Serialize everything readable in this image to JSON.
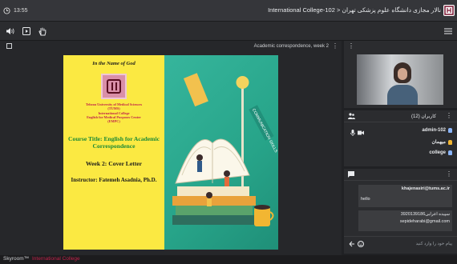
{
  "topbar": {
    "time": "13:55",
    "title": "International College-102 > نالار مجازی دانشگاه علوم پزشکی تهران"
  },
  "main": {
    "title": "Academic correspondence, week 2",
    "slide": {
      "heading": "In the Name of God",
      "institution": [
        "Tehran University of Medical Sciences",
        "(TUMS)",
        "International College",
        "English for Medical Purposes Center",
        "(EMPC)"
      ],
      "course": "Course Title: English for Academic Correspondence",
      "week": "Week 2: Cover Letter",
      "instructor": "Instructor: Fatemeh Asadnia, Ph.D.",
      "sign_text": "COMMUNICATION SKILLS"
    }
  },
  "participants": {
    "header": "کاربران (12)",
    "list": [
      {
        "name": "admin-102"
      },
      {
        "name": "میهمان"
      },
      {
        "name": "college"
      }
    ]
  },
  "chat": {
    "messages": [
      {
        "lines": [
          "khajenasiri@tums.ac.ir",
          "hello"
        ]
      },
      {
        "lines": [
          "سپیده اعرابی3920139186",
          "sepideharabi@gmail.com"
        ]
      }
    ],
    "input_placeholder": "پیام خود را وارد کنید"
  },
  "statusbar": {
    "brand": "Skyroom™",
    "right": "International College"
  },
  "colors": {
    "accent": "#8ab4f8",
    "yellow": "#fbe942",
    "green": "#2aa88d"
  }
}
